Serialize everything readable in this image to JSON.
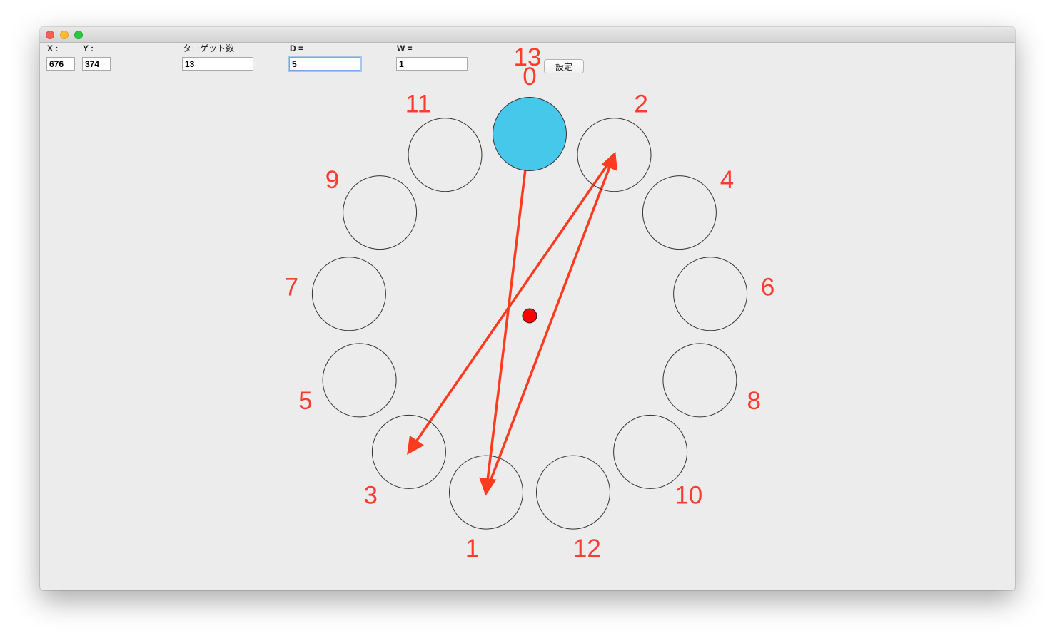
{
  "controls": {
    "x_label": "X :",
    "x_value": "676",
    "y_label": "Y :",
    "y_value": "374",
    "target_count_label": "ターゲット数",
    "target_count_value": "13",
    "d_label": "D =",
    "d_value": "5",
    "w_label": "W =",
    "w_value": "1",
    "set_button_label": "設定"
  },
  "target_count_display": "13",
  "targets": [
    {
      "label": "0",
      "state": "highlighted"
    },
    {
      "label": "1",
      "state": "normal"
    },
    {
      "label": "2",
      "state": "normal"
    },
    {
      "label": "3",
      "state": "normal"
    },
    {
      "label": "4",
      "state": "normal"
    },
    {
      "label": "5",
      "state": "normal"
    },
    {
      "label": "6",
      "state": "normal"
    },
    {
      "label": "7",
      "state": "normal"
    },
    {
      "label": "8",
      "state": "normal"
    },
    {
      "label": "9",
      "state": "normal"
    },
    {
      "label": "10",
      "state": "normal"
    },
    {
      "label": "11",
      "state": "normal"
    },
    {
      "label": "12",
      "state": "normal"
    }
  ],
  "arrow_sequence": [
    0,
    1,
    2,
    3
  ],
  "colors": {
    "highlight_fill": "#46c8ea",
    "arrow": "#ff3b1f",
    "label": "#ff3b30",
    "center_dot": "#ff0000"
  }
}
